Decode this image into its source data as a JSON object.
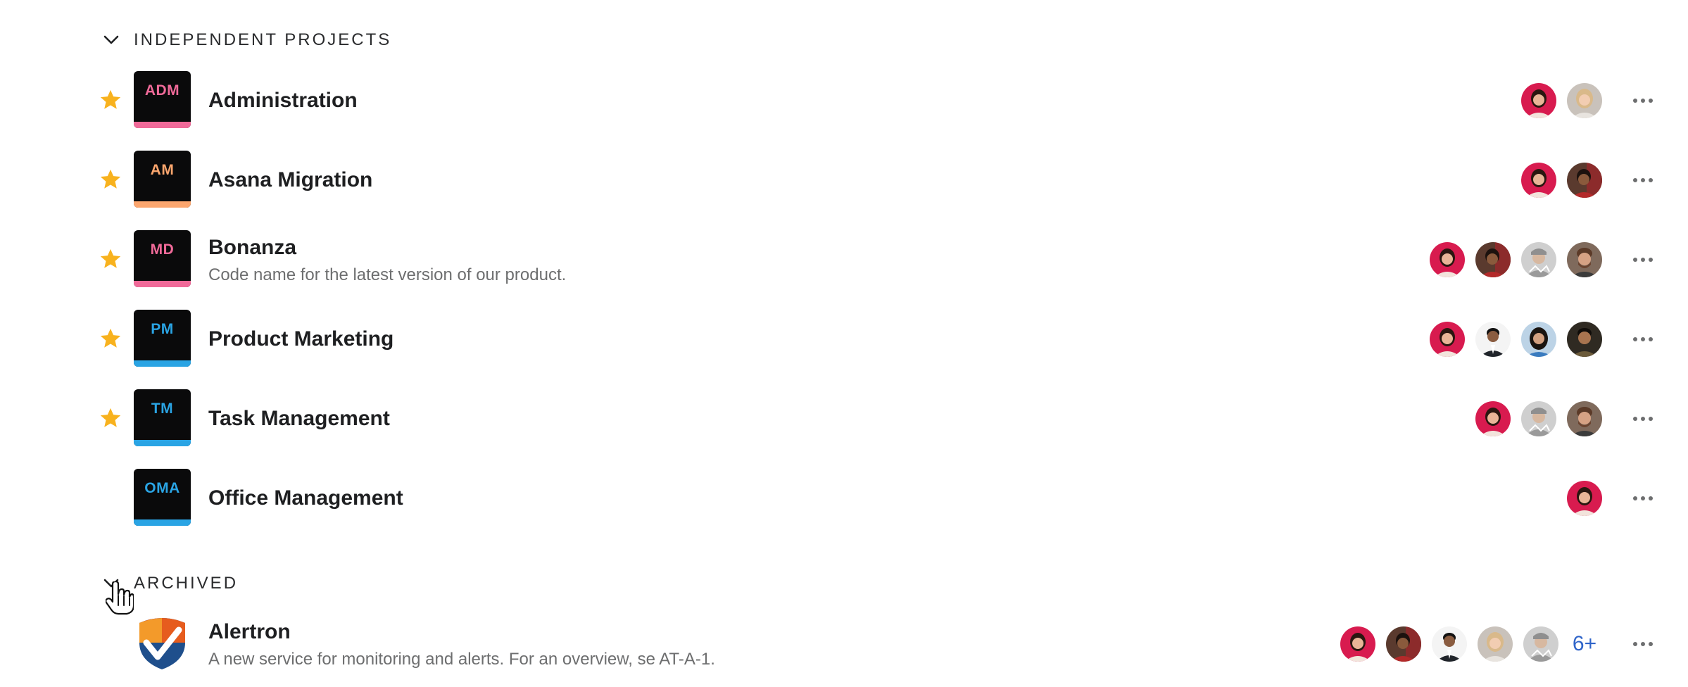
{
  "sections": {
    "independent": {
      "title": "INDEPENDENT PROJECTS"
    },
    "archived": {
      "title": "ARCHIVED"
    }
  },
  "colors": {
    "star": "#f8b21e",
    "tile_bg": "#0a0a0b",
    "pink": "#f06a99",
    "orange": "#fca66e",
    "blue": "#2aa4e4",
    "more_count": "#2f64c9"
  },
  "projects": [
    {
      "abbr": "ADM",
      "name": "Administration",
      "description": "",
      "starred": true,
      "accent": "#f06a99",
      "members": [
        "user-red",
        "user-blonde"
      ]
    },
    {
      "abbr": "AM",
      "name": "Asana Migration",
      "description": "",
      "starred": true,
      "accent": "#fca66e",
      "members": [
        "user-red",
        "user-dark"
      ]
    },
    {
      "abbr": "MD",
      "name": "Bonanza",
      "description": "Code name for the latest version of our product.",
      "starred": true,
      "accent": "#f06a99",
      "members": [
        "user-red",
        "user-dark",
        "user-grey",
        "user-beard"
      ]
    },
    {
      "abbr": "PM",
      "name": "Product Marketing",
      "description": "",
      "starred": true,
      "accent": "#2aa4e4",
      "members": [
        "user-red",
        "user-suit",
        "user-glasses",
        "user-dark"
      ]
    },
    {
      "abbr": "TM",
      "name": "Task Management",
      "description": "",
      "starred": true,
      "accent": "#2aa4e4",
      "members": [
        "user-red",
        "user-grey",
        "user-beard"
      ]
    },
    {
      "abbr": "OMA",
      "name": "Office Management",
      "description": "",
      "starred": false,
      "accent": "#2aa4e4",
      "members": [
        "user-red"
      ]
    }
  ],
  "archived_projects": [
    {
      "name": "Alertron",
      "description": "A new service for monitoring and alerts. For an overview, se AT-A-1.",
      "logo": "shield-logo",
      "members": [
        "user-red",
        "user-dark",
        "user-suit",
        "user-blonde",
        "user-grey"
      ],
      "more_members": "6+"
    }
  ],
  "icons": {
    "collapse": "chevron-down-icon",
    "star": "star-icon",
    "menu": "more-horizontal-icon",
    "pointer": "hand-pointer-cursor"
  }
}
